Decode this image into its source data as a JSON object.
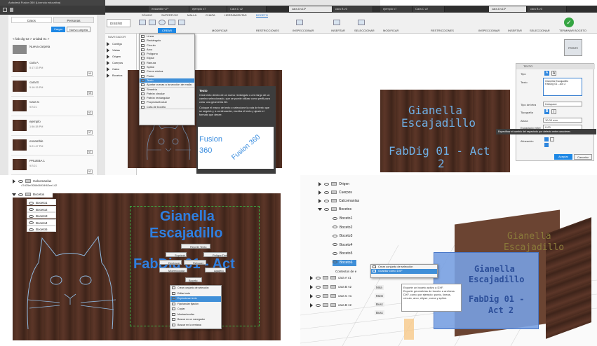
{
  "tl": {
    "title": "Autodesk Fusion 360 (Licencia educativa)",
    "tabs": [
      "Datos",
      "Personas"
    ],
    "upload": "Cargar",
    "new_project": "Nuevo carpeta",
    "breadcrumb": "< fab dig 02 > unidad 01 >",
    "new_folder": "Nueva carpeta",
    "files": [
      {
        "name": "cara A",
        "date": "5:17:33 PM",
        "ver": "V4"
      },
      {
        "name": "cara B",
        "date": "5:16:15 PM",
        "ver": "V5"
      },
      {
        "name": "Cara C",
        "date": "9/7/21",
        "ver": "V2"
      },
      {
        "name": "ejemplo",
        "date": "1:56:38 PM",
        "ver": "V7"
      },
      {
        "name": "ensamble",
        "date": "5:21:47 PM",
        "ver": "V7"
      },
      {
        "name": "PRUEBA 1",
        "date": "9/7/21",
        "ver": "V1"
      }
    ],
    "doc_tabs": [
      "ensamble v7*",
      "ejemplo v7",
      "Cara C v2",
      "cara A v13*",
      "cara B v3"
    ],
    "ribbon_tabs": [
      "SÓLIDO",
      "SUPERFICIE",
      "MALLA",
      "CHAPA",
      "HERRAMIENTAS",
      "BOCETO"
    ],
    "design": "DISEÑO",
    "crear": "CREAR",
    "modificar": "MODIFICAR",
    "restricciones": "RESTRICCIONES",
    "inspeccionar": "INSPECCIONAR",
    "insertar": "INSERTAR",
    "seleccionar": "SELECCIONAR",
    "navegador": "NAVEGADOR",
    "menu": [
      "Línea",
      "Rectángulo",
      "Círculo",
      "Arco",
      "Polígono",
      "Elipse",
      "Ranura",
      "Spline",
      "Curva cónica",
      "Punto",
      "Texto",
      "Ajustar curvas a la sección de malla",
      "Simetría",
      "Patrón circular",
      "Patrón rectangular",
      "Proyectar/Incluir",
      "Cota de boceto"
    ],
    "browser_items": [
      "Configu",
      "Vistas",
      "Origen",
      "Cuerpos",
      "Calco",
      "Bocetos"
    ],
    "tooltip_title": "Texto",
    "tooltip_p1": "Crea texto dentro de un nuevo rectángulo o a lo largo de un camino seleccionado, que se puede utilizar como perfil para crear una geometría 3D.",
    "tooltip_p2": "Coloque el marco de texto o seleccione la ruta de texto que se seguirá y, a continuación, escriba el texto y ajuste el formato que desee.",
    "fusion_a": "Fusion",
    "fusion_b": "360",
    "fusion_c": "Fusion 360"
  },
  "tr": {
    "doc_tabs": [
      "ejemplo v7",
      "Cara C v2",
      "cara A v13*",
      "cara B v3"
    ],
    "modificar": "MODIFICAR",
    "restricciones": "RESTRICCIONES",
    "inspeccionar": "INSPECCIONAR",
    "insertar": "INSERTAR",
    "seleccionar": "SELECCIONAR",
    "terminar": "TERMINAR BOCETO",
    "cube": "FRENTE",
    "carved_l1": "Gianella",
    "carved_l2": "Escajadillo",
    "carved_l3": "FabDig 01 - Act",
    "carved_l4": "2",
    "panel_title": "TEXTO",
    "tipo": "Tipo",
    "texto": "Texto",
    "text_value": "Gianella Escajadillo\nFabDig 01 - Act 2",
    "tipo_letra": "Tipo de letra",
    "tipo_letra_val": "Unispace",
    "tipografia": "Tipografía",
    "altura": "Altura",
    "altura_val": "10.00 mm",
    "espaciado": "Espaciado entre",
    "espaciado_val": "0.00",
    "tooltip": "Especificar el cambio del espaciado por defecto entre caracteres",
    "alineacion": "Alineación",
    "aceptar": "Aceptar",
    "cancelar": "Cancelar"
  },
  "bl": {
    "top_row": "47d25e0f26666934f62ee142",
    "calcomanias": "Calcomanías",
    "bocetos": "Bocetos",
    "sketches": [
      "Boceto1",
      "Boceto2",
      "Boceto3",
      "Boceto4",
      "Boceto5"
    ],
    "name_l1": "Gianella",
    "name_l2": "Escajadillo",
    "name_l3": "FabDig 01 - Act",
    "ctx_top": [
      "Repetir Texto"
    ],
    "ctx_row2": [
      "Suprimir",
      "PolígonTrist"
    ],
    "ctx_row3": [
      "Deshacer",
      "Rehacer"
    ],
    "ctx_row4": [
      "Mover/copiar",
      "Agujero"
    ],
    "ctx_boceto": "Boceto",
    "ctx_list": [
      "Crear conjunto de selección",
      "Editar texto",
      "Explosionar texto",
      "Fijar/anclar fijación",
      "Copiar",
      "Mostrar/ocultar",
      "Buscar en un navegador",
      "Buscar en la ventana"
    ]
  },
  "br": {
    "tree": [
      "Origen",
      "Cuerpos",
      "Calcomanías",
      "Bocetos"
    ],
    "sketches": [
      "Boceto1",
      "Boceto2",
      "Boceto3",
      "Boceto4",
      "Boceto5",
      "Boceto6"
    ],
    "contexts": "Contextos de e",
    "caras": [
      "cara A v1",
      "cara B v2",
      "cara C v1",
      "cara B v2"
    ],
    "ctx": [
      "Crear conjunto de selección",
      "Guardar como DXF"
    ],
    "side": [
      "Mira",
      "Most",
      "Busc",
      "Busc"
    ],
    "tip_l1": "Exporte un boceto activo a DXF.",
    "tip_l2": "Exporte geometrías de boceto a archivos DXF, como por ejemplo: punto, líneas, círculo, arco, elipse, curva y spline.",
    "box_l1": "Gianella",
    "box_l2": "Escajadillo",
    "box_l3": "FabDig 01 -",
    "box_l4": "Act 2"
  }
}
